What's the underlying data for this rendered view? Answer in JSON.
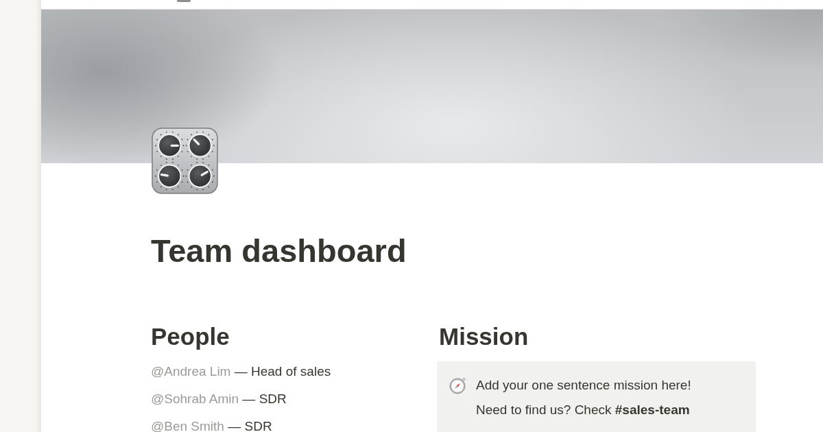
{
  "page": {
    "title": "Team dashboard"
  },
  "people": {
    "heading": "People",
    "members": [
      {
        "mention": "@Andrea Lim",
        "role": "— Head of sales"
      },
      {
        "mention": "@Sohrab Amin",
        "role": "— SDR"
      },
      {
        "mention": "@Ben Smith",
        "role": "— SDR"
      }
    ]
  },
  "mission": {
    "heading": "Mission",
    "callout": [
      "Add your one sentence mission here!",
      "Need to find us? Check **#sales-team**"
    ]
  }
}
